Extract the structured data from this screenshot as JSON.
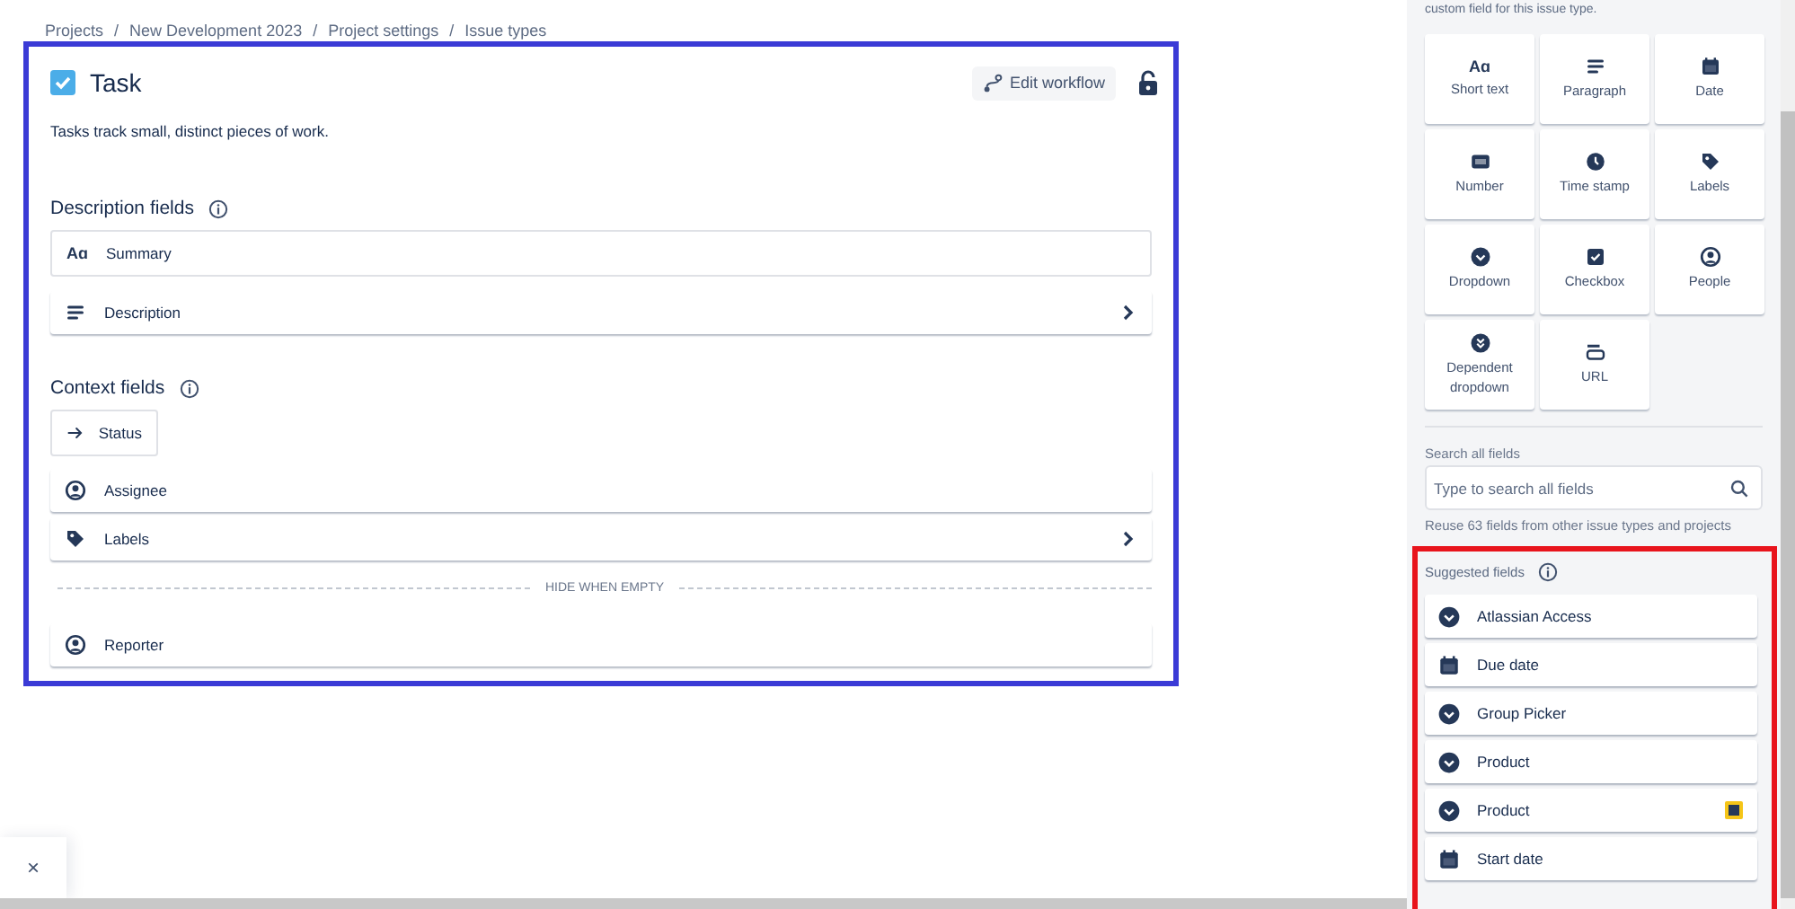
{
  "breadcrumb": [
    "Projects",
    "New Development 2023",
    "Project settings",
    "Issue types"
  ],
  "breadcrumb_separator": "/",
  "issue_type": {
    "name": "Task",
    "description": "Tasks track small, distinct pieces of work.",
    "edit_workflow": "Edit workflow"
  },
  "description_fields": {
    "title": "Description fields",
    "fields": [
      {
        "label": "Summary",
        "kind": "short-text",
        "glyph": "Aɑ",
        "expandable": false
      },
      {
        "label": "Description",
        "kind": "paragraph",
        "expandable": true
      }
    ]
  },
  "context_fields": {
    "title": "Context fields",
    "fields": [
      {
        "label": "Status",
        "kind": "status",
        "expandable": false
      },
      {
        "label": "Assignee",
        "kind": "people",
        "expandable": false
      },
      {
        "label": "Labels",
        "kind": "labels",
        "expandable": true
      }
    ],
    "hide_when_empty": "HIDE WHEN EMPTY",
    "hidden_fields": [
      {
        "label": "Reporter",
        "kind": "people",
        "expandable": false
      }
    ]
  },
  "field_panel": {
    "hint": "custom field for this issue type.",
    "field_types": [
      {
        "label": "Short text",
        "kind": "short-text",
        "glyph": "Aɑ"
      },
      {
        "label": "Paragraph",
        "kind": "paragraph"
      },
      {
        "label": "Date",
        "kind": "date"
      },
      {
        "label": "Number",
        "kind": "number"
      },
      {
        "label": "Time stamp",
        "kind": "timestamp"
      },
      {
        "label": "Labels",
        "kind": "labels"
      },
      {
        "label": "Dropdown",
        "kind": "dropdown"
      },
      {
        "label": "Checkbox",
        "kind": "checkbox"
      },
      {
        "label": "People",
        "kind": "people"
      },
      {
        "label": "Dependent dropdown",
        "kind": "dependent"
      },
      {
        "label": "URL",
        "kind": "url"
      }
    ],
    "search": {
      "label": "Search all fields",
      "placeholder": "Type to search all fields",
      "hint": "Reuse 63 fields from other issue types and projects"
    },
    "suggested": {
      "title": "Suggested fields",
      "fields": [
        {
          "label": "Atlassian Access",
          "kind": "dropdown",
          "tagged": false
        },
        {
          "label": "Due date",
          "kind": "date",
          "tagged": false
        },
        {
          "label": "Group Picker",
          "kind": "dropdown",
          "tagged": false
        },
        {
          "label": "Product",
          "kind": "dropdown",
          "tagged": false
        },
        {
          "label": "Product",
          "kind": "dropdown",
          "tagged": true
        },
        {
          "label": "Start date",
          "kind": "date",
          "tagged": false
        }
      ]
    }
  },
  "toast": {
    "close": "×"
  }
}
